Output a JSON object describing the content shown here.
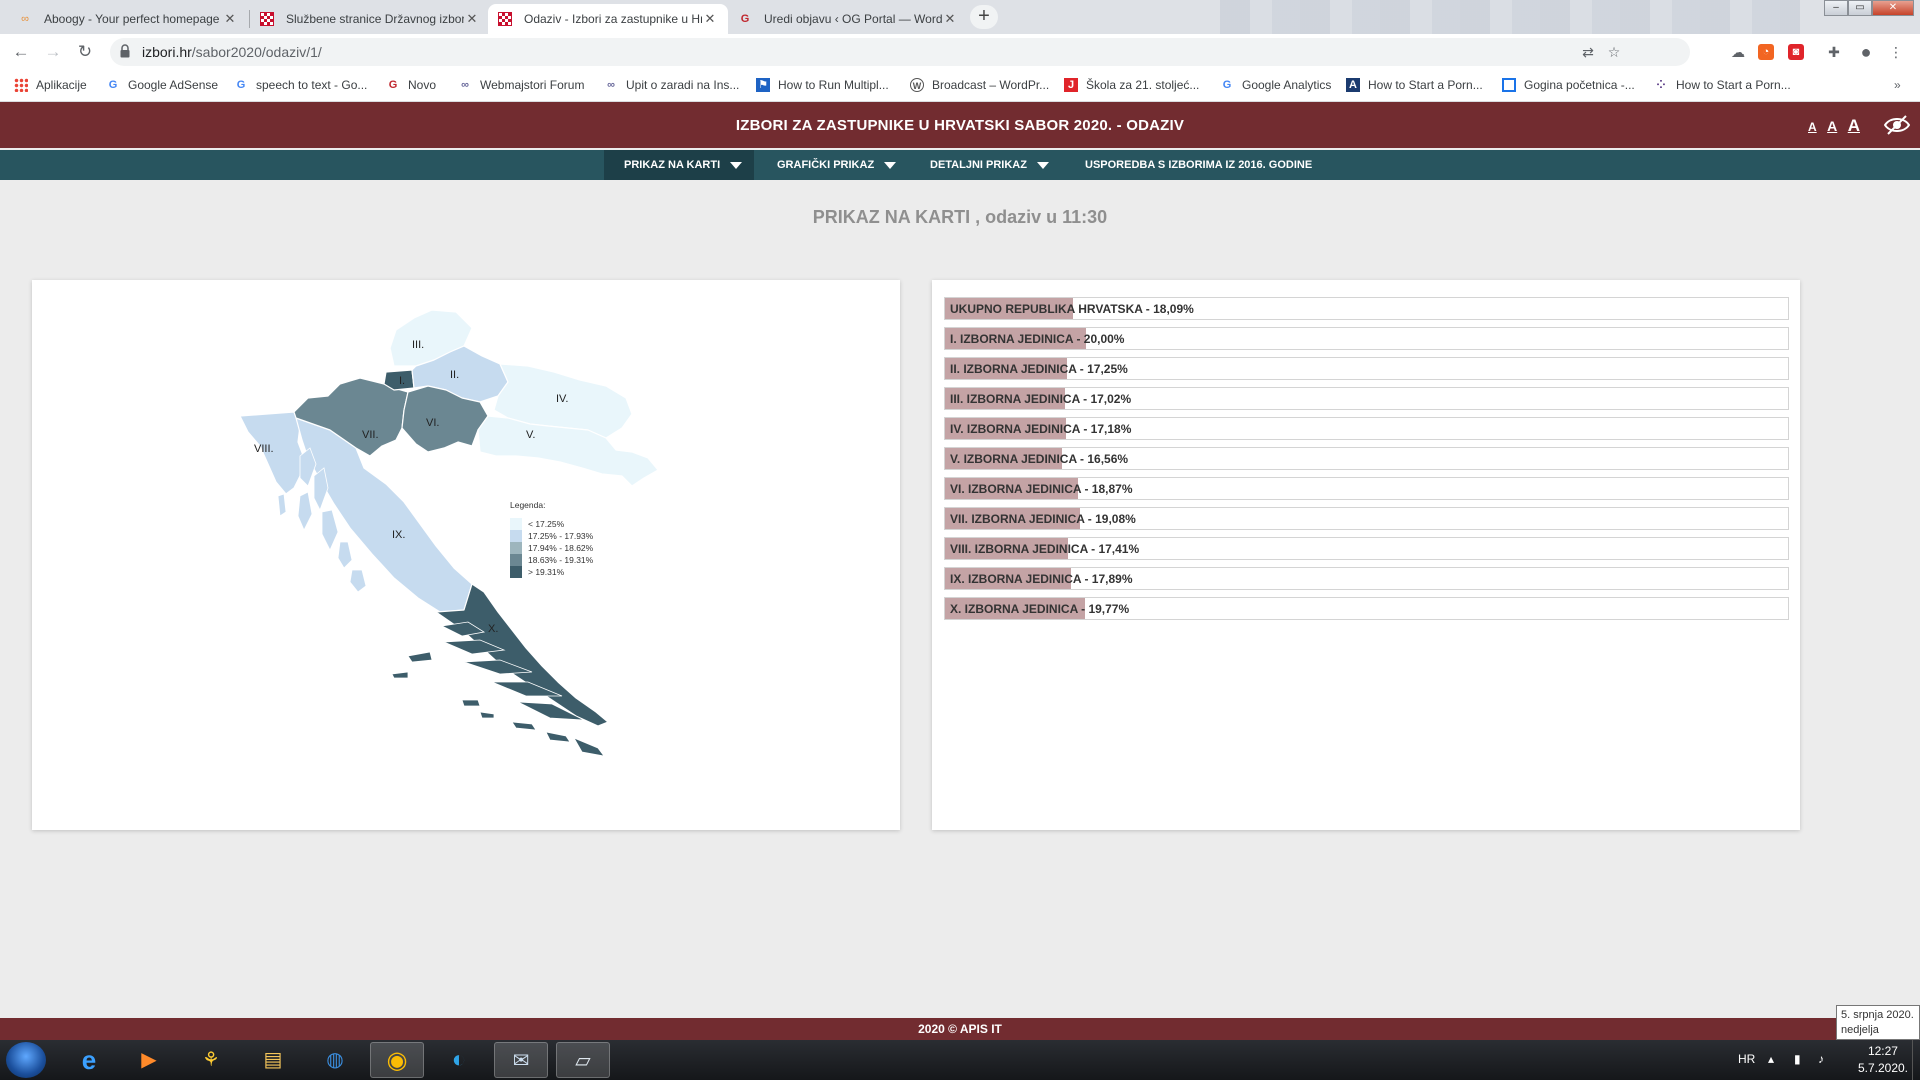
{
  "browser": {
    "tabs": [
      {
        "title": "Aboogy - Your perfect homepage",
        "icon": "aboogy-icon"
      },
      {
        "title": "Službene stranice Državnog izbornog povjerenstva",
        "icon": "croatia-coat-icon"
      },
      {
        "title": "Odaziv - Izbori za zastupnike u Hrvatski sabor",
        "icon": "croatia-coat-icon"
      },
      {
        "title": "Uredi objavu ‹ OG Portal — WordPress",
        "icon": "og-portal-icon"
      }
    ],
    "url_host": "izbori.hr",
    "url_path": "/sabor2020/odaziv/1/",
    "bookmarks": [
      {
        "label": "Aplikacije",
        "icon": "apps-grid-icon"
      },
      {
        "label": "Google AdSense",
        "icon": "google-icon"
      },
      {
        "label": "speech to text - Go...",
        "icon": "google-icon"
      },
      {
        "label": "Novo",
        "icon": "og-portal-icon"
      },
      {
        "label": "Webmajstori Forum",
        "icon": "webmajstori-icon"
      },
      {
        "label": "Upit o zaradi na Ins...",
        "icon": "webmajstori-icon"
      },
      {
        "label": "How to Run Multipl...",
        "icon": "flag-icon"
      },
      {
        "label": "Broadcast – WordPr...",
        "icon": "wordpress-icon"
      },
      {
        "label": "Škola za 21. stoljeć...",
        "icon": "red-j-icon"
      },
      {
        "label": "Google Analytics",
        "icon": "google-icon"
      },
      {
        "label": "How to Start a Porn...",
        "icon": "a-logo-icon"
      },
      {
        "label": "Gogina početnica -...",
        "icon": "blue-square-icon"
      },
      {
        "label": "How to Start a Porn...",
        "icon": "dots-icon"
      }
    ]
  },
  "site": {
    "title": "IZBORI ZA ZASTUPNIKE U HRVATSKI SABOR 2020. - ODAZIV",
    "font_sizes": [
      "A",
      "A",
      "A"
    ],
    "nav": [
      {
        "label": "PRIKAZ NA KARTI",
        "dropdown": true
      },
      {
        "label": "GRAFIČKI PRIKAZ",
        "dropdown": true
      },
      {
        "label": "DETALJNI PRIKAZ",
        "dropdown": true
      },
      {
        "label": "USPOREDBA S IZBORIMA IZ 2016. GODINE",
        "dropdown": false
      }
    ],
    "heading": "PRIKAZ NA KARTI , odaziv u 11:30",
    "footer": "2020 © APIS IT"
  },
  "map": {
    "legend_title": "Legenda:",
    "legend": [
      {
        "label": "< 17.25%",
        "color": "#e9f6fb"
      },
      {
        "label": "17.25% - 17.93%",
        "color": "#c6dbef"
      },
      {
        "label": "17.94% - 18.62%",
        "color": "#9db5bd"
      },
      {
        "label": "18.63% - 19.31%",
        "color": "#6b8792"
      },
      {
        "label": "> 19.31%",
        "color": "#3d5d6a"
      }
    ],
    "regions": [
      {
        "label": "I.",
        "turnout": 20.0
      },
      {
        "label": "II.",
        "turnout": 17.25
      },
      {
        "label": "III.",
        "turnout": 17.02
      },
      {
        "label": "IV.",
        "turnout": 17.18
      },
      {
        "label": "V.",
        "turnout": 16.56
      },
      {
        "label": "VI.",
        "turnout": 18.87
      },
      {
        "label": "VII.",
        "turnout": 19.08
      },
      {
        "label": "VIII.",
        "turnout": 17.41
      },
      {
        "label": "IX.",
        "turnout": 17.89
      },
      {
        "label": "X.",
        "turnout": 19.77
      }
    ]
  },
  "chart_data": {
    "type": "bar",
    "orientation": "horizontal",
    "xlim": [
      0,
      100
    ],
    "bar_color": "#c4a3a5",
    "categories": [
      "UKUPNO REPUBLIKA HRVATSKA",
      "I. IZBORNA JEDINICA",
      "II. IZBORNA JEDINICA",
      "III. IZBORNA JEDINICA",
      "IV. IZBORNA JEDINICA",
      "V. IZBORNA JEDINICA",
      "VI. IZBORNA JEDINICA",
      "VII. IZBORNA JEDINICA",
      "VIII. IZBORNA JEDINICA",
      "IX. IZBORNA JEDINICA",
      "X. IZBORNA JEDINICA"
    ],
    "values": [
      18.09,
      20.0,
      17.25,
      17.02,
      17.18,
      16.56,
      18.87,
      19.08,
      17.41,
      17.89,
      19.77
    ],
    "labels": [
      "UKUPNO REPUBLIKA HRVATSKA - 18,09%",
      "I. IZBORNA JEDINICA - 20,00%",
      "II. IZBORNA JEDINICA - 17,25%",
      "III. IZBORNA JEDINICA - 17,02%",
      "IV. IZBORNA JEDINICA - 17,18%",
      "V. IZBORNA JEDINICA - 16,56%",
      "VI. IZBORNA JEDINICA - 18,87%",
      "VII. IZBORNA JEDINICA - 19,08%",
      "VIII. IZBORNA JEDINICA - 17,41%",
      "IX. IZBORNA JEDINICA - 17,89%",
      "X. IZBORNA JEDINICA - 19,77%"
    ]
  },
  "taskbar": {
    "language": "HR",
    "time": "12:27",
    "date": "5.7.2020.",
    "tooltip_date": "5. srpnja 2020.",
    "tooltip_day": "nedjelja"
  }
}
